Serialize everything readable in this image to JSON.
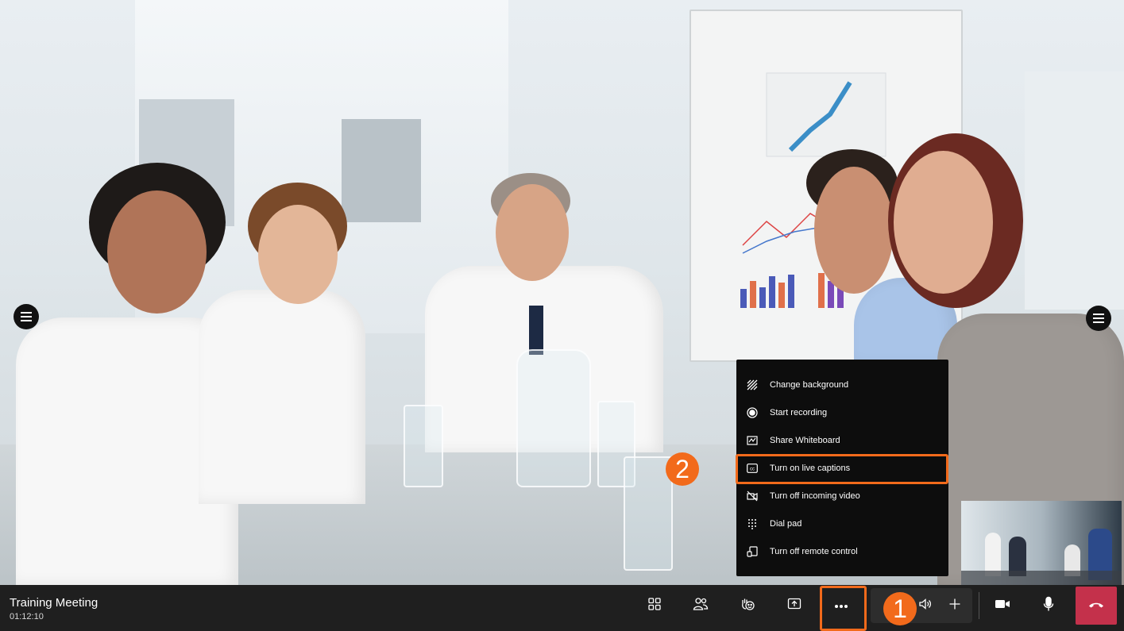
{
  "meeting": {
    "title": "Training Meeting",
    "duration": "01:12:10"
  },
  "more_menu": {
    "items": [
      {
        "label": "Change background",
        "icon": "background-icon"
      },
      {
        "label": "Start recording",
        "icon": "record-icon"
      },
      {
        "label": "Share Whiteboard",
        "icon": "whiteboard-icon"
      },
      {
        "label": "Turn on live captions",
        "icon": "captions-icon",
        "highlighted": true
      },
      {
        "label": "Turn off incoming video",
        "icon": "video-off-icon"
      },
      {
        "label": "Dial pad",
        "icon": "dialpad-icon"
      },
      {
        "label": "Turn off remote control",
        "icon": "remote-control-icon"
      }
    ]
  },
  "callouts": {
    "step1": "1",
    "step2": "2"
  },
  "toolbar": {
    "buttons": [
      "layout-icon",
      "participants-icon",
      "reactions-icon",
      "share-icon",
      "more-icon",
      "volume-icon",
      "add-icon",
      "camera-icon",
      "mic-icon",
      "hangup-icon"
    ]
  },
  "colors": {
    "accent_callout": "#f26a1b",
    "hangup": "#c4314b",
    "bar": "#1f1f1f",
    "menu_bg": "#0d0d0d"
  }
}
